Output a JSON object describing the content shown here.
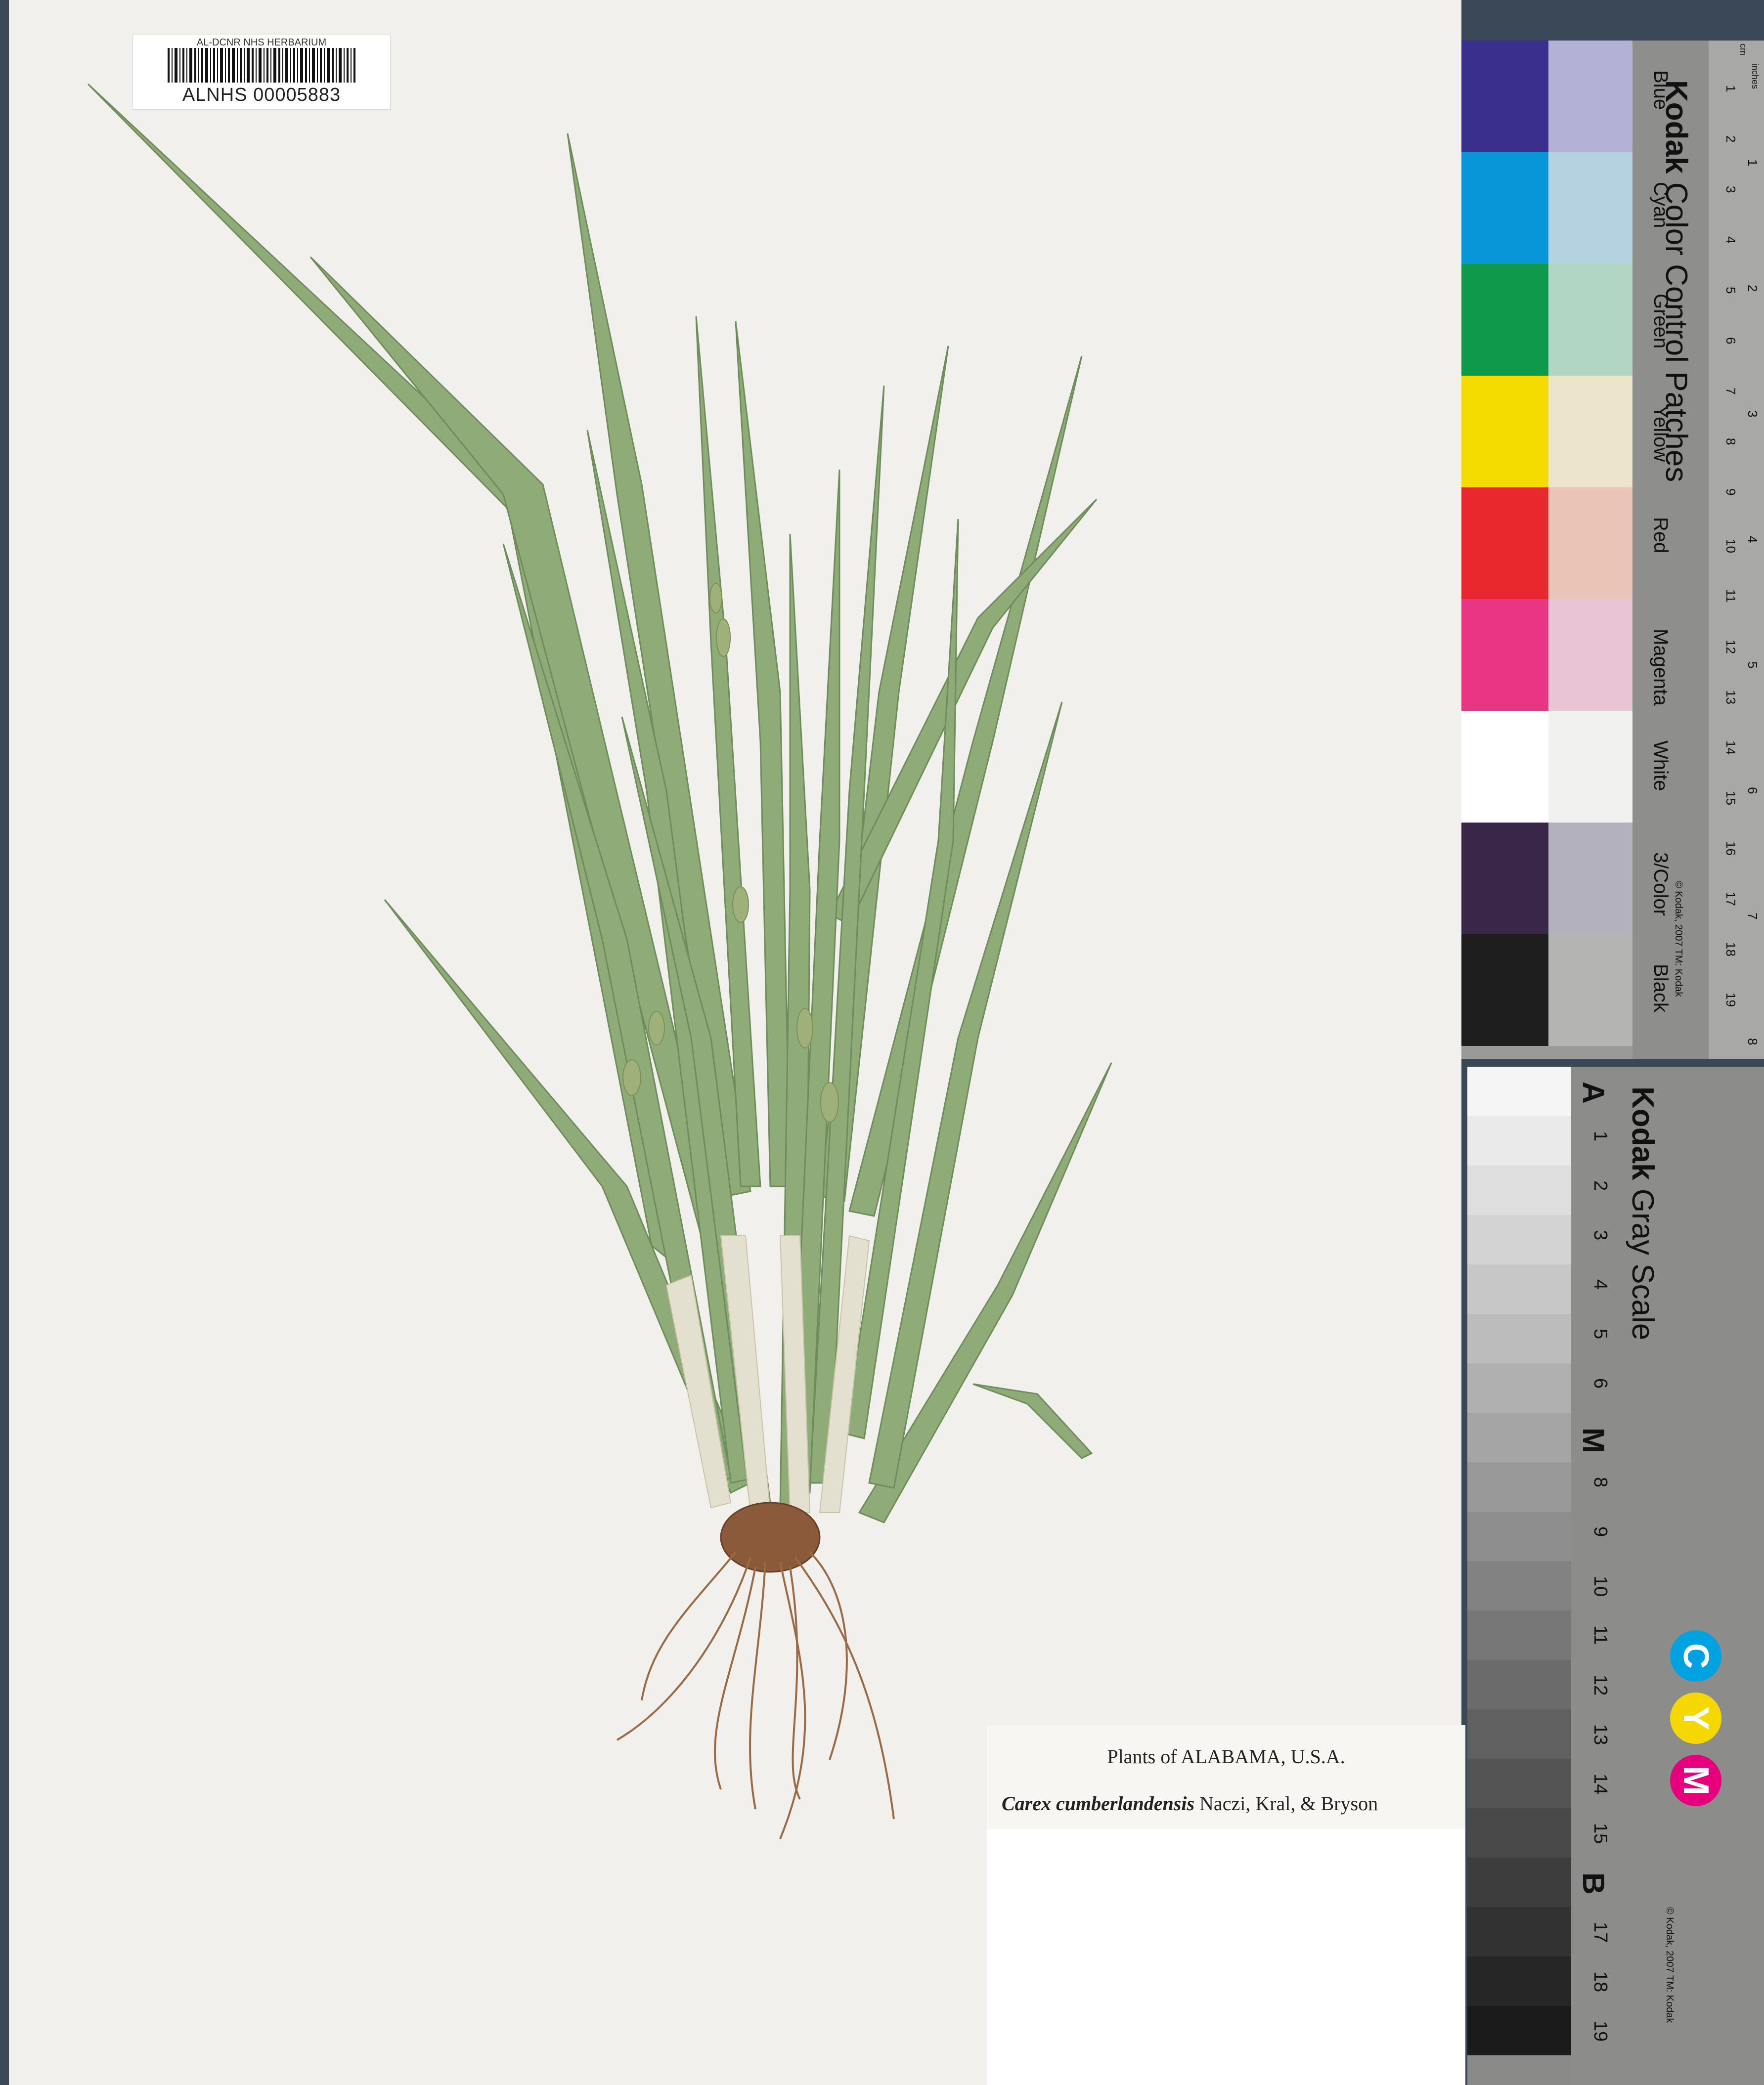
{
  "barcode_label": {
    "institution": "AL-DCNR NHS HERBARIUM",
    "catalog_number": "ALNHS 00005883"
  },
  "herbarium_label": {
    "title": "Plants of ALABAMA, U.S.A.",
    "scientific_name": "Carex cumberlandensis",
    "authority": " Naczi, Kral, & Bryson"
  },
  "color_card": {
    "brand": "Kodak",
    "title": " Color Control Patches",
    "patch_names": [
      "Blue",
      "Cyan",
      "Green",
      "Yellow",
      "Red",
      "Magenta",
      "White",
      "3/Color",
      "Black"
    ],
    "patch_colors_a": [
      "#3b2f8e",
      "#0796d8",
      "#0e9a4a",
      "#f4dc00",
      "#e8282c",
      "#e93583",
      "#ffffff",
      "#3a2748",
      "#1e1e1e"
    ],
    "patch_colors_b": [
      "#b4b1d6",
      "#b4d2e0",
      "#b2d6c4",
      "#ece5cc",
      "#ebc4b8",
      "#e8c4d4",
      "#f0f0ee",
      "#b4b1be",
      "#b4b4b2"
    ],
    "ruler_cm": [
      "1",
      "2",
      "3",
      "4",
      "5",
      "6",
      "7",
      "8",
      "9",
      "10",
      "11",
      "12",
      "13",
      "14",
      "15",
      "16",
      "17",
      "18",
      "19"
    ],
    "ruler_units": [
      "cm",
      "inches"
    ],
    "ruler_inches": [
      "1",
      "2",
      "3",
      "4",
      "5",
      "6",
      "7",
      "8"
    ],
    "copyright": "© Kodak, 2007 TM: Kodak"
  },
  "gray_card": {
    "brand": "Kodak",
    "title": " Gray Scale",
    "labels": [
      "A",
      "1",
      "2",
      "3",
      "4",
      "5",
      "6",
      "M",
      "8",
      "9",
      "10",
      "11",
      "12",
      "13",
      "14",
      "15",
      "B",
      "17",
      "18",
      "19"
    ],
    "cym": [
      "C",
      "Y",
      "M"
    ],
    "cym_colors": [
      "#00a3e0",
      "#f5d800",
      "#e6007e"
    ],
    "copyright": "© Kodak, 2007 TM: Kodak"
  }
}
